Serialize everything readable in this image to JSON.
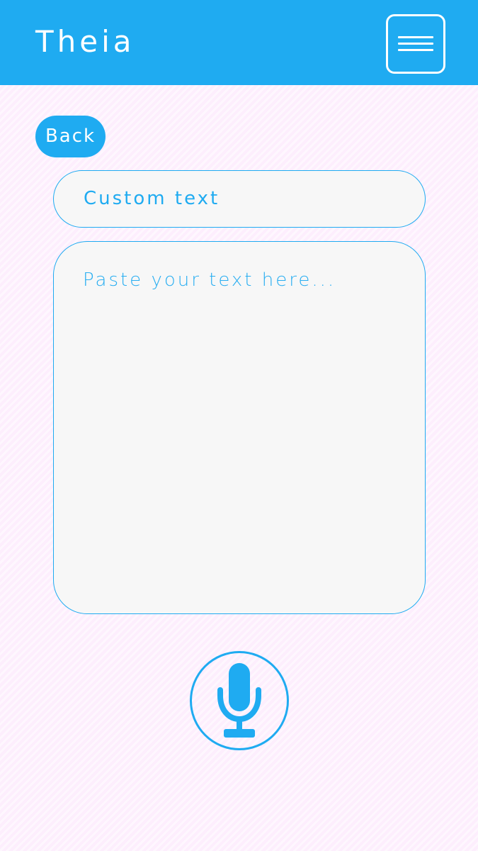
{
  "header": {
    "title": "Theia",
    "menu_icon": "hamburger-menu-icon"
  },
  "back_button": {
    "label": "Back"
  },
  "title_field": {
    "value": "Custom text"
  },
  "text_area": {
    "placeholder": "Paste your text here..."
  },
  "mic_button": {
    "icon": "microphone-icon"
  },
  "colors": {
    "accent": "#1fabf1",
    "background": "#fdeefd",
    "field_background": "#f7f7f7",
    "header_text": "#ffffff"
  }
}
